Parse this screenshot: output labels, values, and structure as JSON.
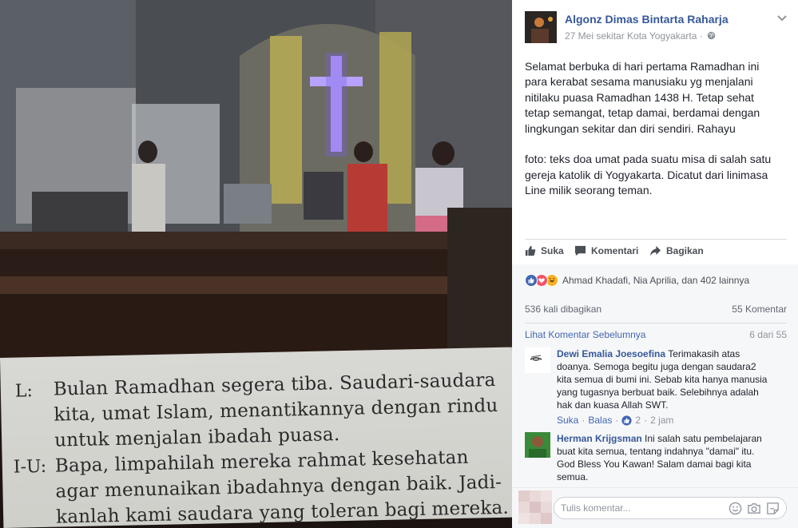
{
  "photo": {
    "paper_lines": [
      {
        "label": "L:",
        "text": "Bulan Ramadhan segera tiba. Saudari-saudara"
      },
      {
        "label": "",
        "text": "kita, umat Islam, menantikannya dengan rindu"
      },
      {
        "label": "",
        "text": "untuk menjalan ibadah puasa."
      },
      {
        "label": "I-U:",
        "text": "Bapa, limpahilah mereka rahmat kesehatan"
      },
      {
        "label": "",
        "text": "agar menunaikan ibadahnya dengan baik. Jadi-"
      },
      {
        "label": "",
        "text": "kanlah kami saudara yang toleran bagi mereka."
      }
    ]
  },
  "post": {
    "author": "Algonz Dimas Bintarta Raharja",
    "meta": "27 Mei sekitar Kota Yogyakarta ·",
    "text": "Selamat berbuka di hari pertama Ramadhan ini para kerabat sesama manusiaku yg menjalani nitilaku puasa Ramadhan 1438 H. Tetap sehat tetap semangat, tetap damai, berdamai dengan lingkungan sekitar dan diri sendiri. Rahayu\n\nfoto: teks doa umat pada suatu misa di salah satu gereja katolik di Yogyakarta. Dicatut dari linimasa Line milik seorang teman."
  },
  "actions": {
    "like": "Suka",
    "comment": "Komentari",
    "share": "Bagikan"
  },
  "reactions": {
    "text": "Ahmad Khadafi, Nia Aprilia, dan 402 lainnya"
  },
  "stats": {
    "shares": "536 kali dibagikan",
    "comments": "55 Komentar"
  },
  "comments_section": {
    "previous": "Lihat Komentar Sebelumnya",
    "count": "6 dari 55",
    "items": [
      {
        "name": "Dewi Emalia Joesoefina",
        "text": "Terimakasih atas doanya. Semoga begitu juga dengan saudara2 kita semua di bumi ini. Sebab kita hanya manusia yang tugasnya berbuat baik. Selebihnya adalah hak dan kuasa Allah SWT.",
        "like": "Suka",
        "reply": "Balas",
        "likes": "2",
        "time": "2 jam"
      },
      {
        "name": "Herman Krijgsman",
        "text": "Ini salah satu pembelajaran buat kita semua, tentang indahnya \"damai\" itu. God Bless You Kawan! Salam damai bagi kita semua."
      }
    ]
  },
  "composer": {
    "placeholder": "Tulis komentar..."
  },
  "colors": {
    "link": "#365899",
    "like_blue": "#4267b2",
    "love_red": "#f25268",
    "haha_yellow": "#f7b125"
  }
}
